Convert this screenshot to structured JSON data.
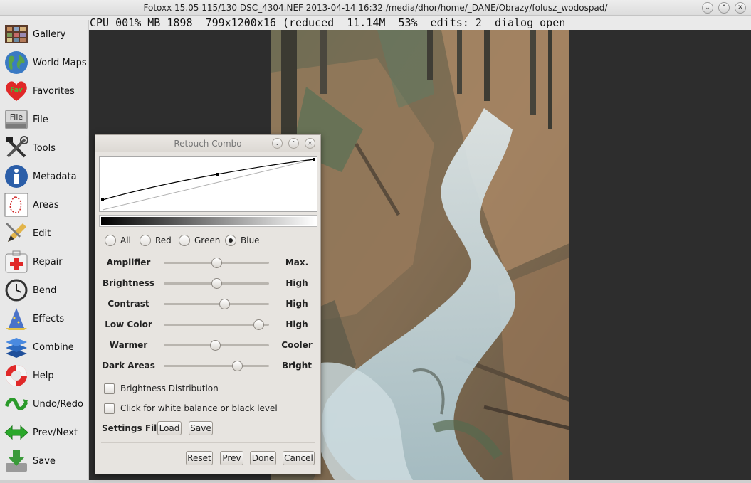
{
  "window": {
    "title": "Fotoxx 15.05  115/130  DSC_4304.NEF  2013-04-14 16:32  /media/dhor/home/_DANE/Obrazy/folusz_wodospad/",
    "buttons": [
      "minimize",
      "maximize",
      "close"
    ]
  },
  "status": {
    "text": "CPU 001% MB 1898  799x1200x16 (reduced  11.14M  53%  edits: 2  dialog open"
  },
  "sidebar": {
    "items": [
      {
        "label": "Gallery",
        "icon": "gallery-icon"
      },
      {
        "label": "World Maps",
        "icon": "globe-icon"
      },
      {
        "label": "Favorites",
        "icon": "heart-icon"
      },
      {
        "label": "File",
        "icon": "file-icon"
      },
      {
        "label": "Tools",
        "icon": "tools-icon"
      },
      {
        "label": "Metadata",
        "icon": "info-icon"
      },
      {
        "label": "Areas",
        "icon": "areas-icon"
      },
      {
        "label": "Edit",
        "icon": "pencil-icon"
      },
      {
        "label": "Repair",
        "icon": "repair-icon"
      },
      {
        "label": "Bend",
        "icon": "bend-icon"
      },
      {
        "label": "Effects",
        "icon": "wizard-icon"
      },
      {
        "label": "Combine",
        "icon": "layers-icon"
      },
      {
        "label": "Help",
        "icon": "lifebuoy-icon"
      },
      {
        "label": "Undo/Redo",
        "icon": "undo-redo-icon"
      },
      {
        "label": "Prev/Next",
        "icon": "prev-next-icon"
      },
      {
        "label": "Save",
        "icon": "save-icon"
      }
    ],
    "file_icon_text": "File",
    "favorites_icon_text": "Fav"
  },
  "dialog": {
    "title": "Retouch Combo",
    "channels": [
      {
        "label": "All",
        "selected": false
      },
      {
        "label": "Red",
        "selected": false
      },
      {
        "label": "Green",
        "selected": false
      },
      {
        "label": "Blue",
        "selected": true
      }
    ],
    "sliders": [
      {
        "left": "Amplifier",
        "right": "Max.",
        "value": 0.5
      },
      {
        "left": "Brightness",
        "right": "High",
        "value": 0.5
      },
      {
        "left": "Contrast",
        "right": "High",
        "value": 0.58
      },
      {
        "left": "Low Color",
        "right": "High",
        "value": 0.9
      },
      {
        "left": "Warmer",
        "right": "Cooler",
        "value": 0.49
      },
      {
        "left": "Dark Areas",
        "right": "Bright",
        "value": 0.7
      }
    ],
    "checkboxes": [
      {
        "label": "Brightness Distribution",
        "checked": false
      },
      {
        "label": "Click for white balance or black level",
        "checked": false
      }
    ],
    "settings_label": "Settings File",
    "load_label": "Load",
    "save_label": "Save",
    "reset_label": "Reset",
    "prev_label": "Prev",
    "done_label": "Done",
    "cancel_label": "Cancel"
  }
}
